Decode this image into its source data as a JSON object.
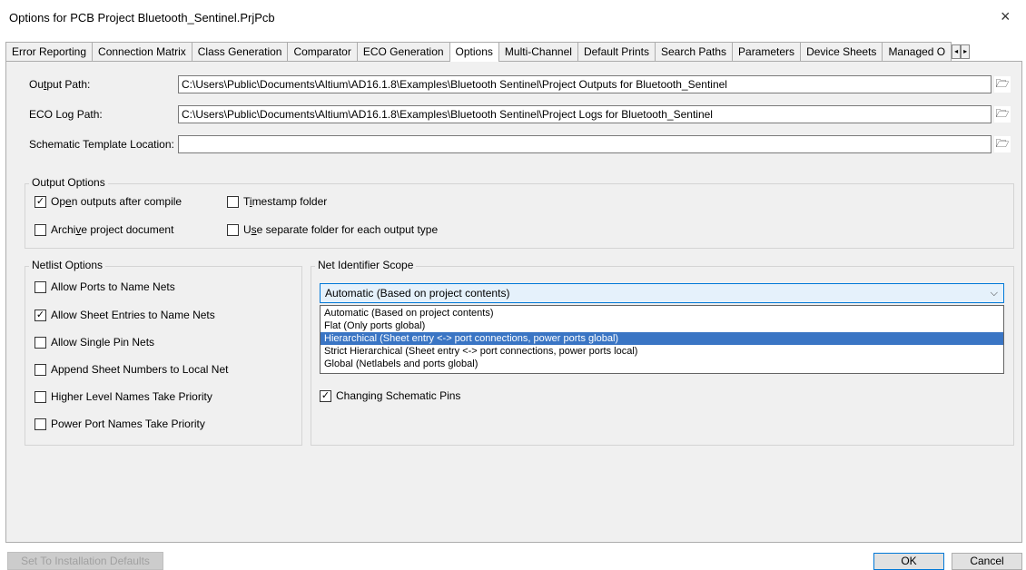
{
  "window": {
    "title": "Options for PCB Project Bluetooth_Sentinel.PrjPcb",
    "close_glyph": "×"
  },
  "tabs": [
    {
      "label": "Error Reporting"
    },
    {
      "label": "Connection Matrix"
    },
    {
      "label": "Class Generation"
    },
    {
      "label": "Comparator"
    },
    {
      "label": "ECO Generation"
    },
    {
      "label": "Options",
      "active": true
    },
    {
      "label": "Multi-Channel"
    },
    {
      "label": "Default Prints"
    },
    {
      "label": "Search Paths"
    },
    {
      "label": "Parameters"
    },
    {
      "label": "Device Sheets"
    },
    {
      "label": "Managed O"
    }
  ],
  "tab_scroll": {
    "left": "◂",
    "right": "▸"
  },
  "paths": {
    "output": {
      "label_pre": "Ou",
      "label_u": "t",
      "label_post": "put Path:",
      "value": "C:\\Users\\Public\\Documents\\Altium\\AD16.1.8\\Examples\\Bluetooth Sentinel\\Project Outputs for Bluetooth_Sentinel"
    },
    "eco": {
      "label": "ECO Log Path:",
      "value": "C:\\Users\\Public\\Documents\\Altium\\AD16.1.8\\Examples\\Bluetooth Sentinel\\Project Logs for Bluetooth_Sentinel"
    },
    "template": {
      "label": "Schematic Template Location:",
      "value": ""
    },
    "folder_glyph": "🗁"
  },
  "output_options": {
    "title": "Output Options",
    "open_outputs": {
      "pre": "Op",
      "u": "e",
      "post": "n outputs after compile",
      "checked": true
    },
    "timestamp": {
      "pre": "T",
      "u": "i",
      "post": "mestamp folder",
      "checked": false
    },
    "archive": {
      "pre": "Archi",
      "u": "v",
      "post": "e project document",
      "checked": false
    },
    "separate": {
      "pre": "U",
      "u": "s",
      "post": "e separate folder for each output type",
      "checked": false
    }
  },
  "netlist_options": {
    "title": "Netlist Options",
    "items": [
      {
        "label": "Allow Ports to Name Nets",
        "checked": false
      },
      {
        "label": "Allow Sheet Entries to Name Nets",
        "checked": true
      },
      {
        "label": "Allow Single Pin Nets",
        "checked": false
      },
      {
        "label": "Append Sheet Numbers to Local Net",
        "checked": false
      },
      {
        "label": "Higher Level Names Take Priority",
        "checked": false
      },
      {
        "label": "Power Port Names Take Priority",
        "checked": false
      }
    ]
  },
  "net_identifier_scope": {
    "title": "Net Identifier Scope",
    "selected": "Automatic (Based on project contents)",
    "arrow": "⌵",
    "options": [
      {
        "label": "Automatic (Based on project contents)",
        "highlighted": false
      },
      {
        "label": "Flat (Only ports global)",
        "highlighted": false
      },
      {
        "label": "Hierarchical (Sheet entry <-> port connections, power ports global)",
        "highlighted": true
      },
      {
        "label": "Strict Hierarchical (Sheet entry <-> port connections, power ports local)",
        "highlighted": false
      },
      {
        "label": "Global (Netlabels and ports global)",
        "highlighted": false
      }
    ]
  },
  "changing_pins": {
    "label": "Changing Schematic Pins",
    "checked": true
  },
  "buttons": {
    "defaults": "Set To Installation Defaults",
    "ok": "OK",
    "cancel": "Cancel"
  },
  "check_glyph": "✓"
}
